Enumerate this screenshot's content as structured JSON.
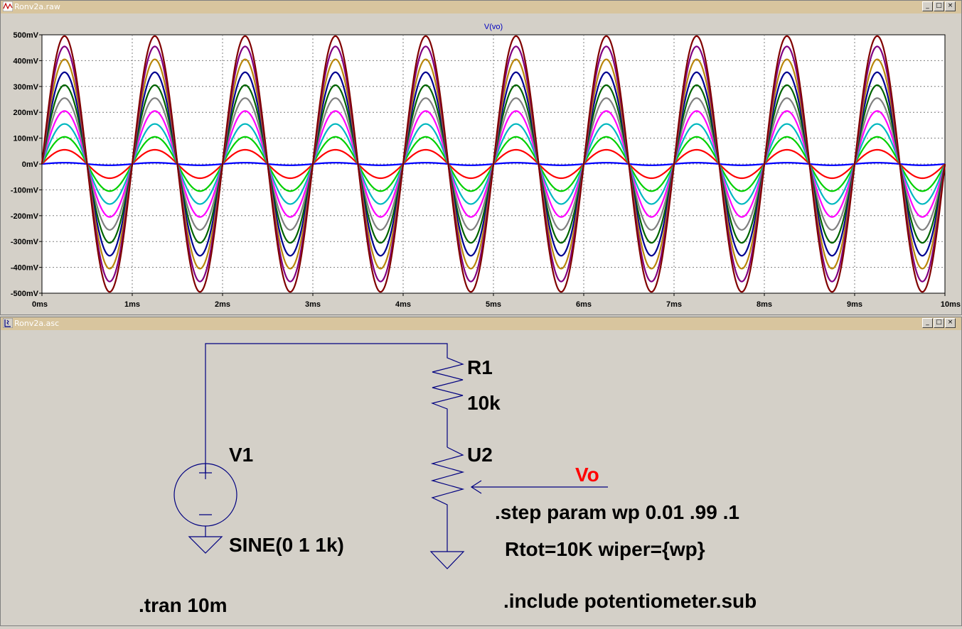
{
  "plot_window": {
    "title": "Ronv2a.raw",
    "trace_label": "V(vo)",
    "icon": "waveform-icon",
    "buttons": {
      "minimize": "_",
      "restore": "□",
      "close": "×"
    }
  },
  "schematic_window": {
    "title": "Ronv2a.asc",
    "icon": "schematic-icon",
    "buttons": {
      "minimize": "_",
      "restore": "□",
      "close": "×"
    },
    "labels": {
      "v1_name": "V1",
      "v1_value": "SINE(0 1 1k)",
      "r1_name": "R1",
      "r1_value": "10k",
      "u2_name": "U2",
      "net_label": "Vo",
      "step_directive": ".step param wp 0.01 .99 .1",
      "u2_params": "Rtot=10K wiper={wp}",
      "tran_directive": ".tran 10m",
      "include_directive": ".include potentiometer.sub"
    },
    "net_label_color": "#ff0000"
  },
  "chart_data": {
    "type": "line",
    "title": "V(vo)",
    "xlabel": "",
    "ylabel": "",
    "x_ticks": [
      "0ms",
      "1ms",
      "2ms",
      "3ms",
      "4ms",
      "5ms",
      "6ms",
      "7ms",
      "8ms",
      "9ms",
      "10ms"
    ],
    "y_ticks": [
      "500mV",
      "400mV",
      "300mV",
      "200mV",
      "100mV",
      "0mV",
      "-100mV",
      "-200mV",
      "-300mV",
      "-400mV",
      "-500mV"
    ],
    "xlim": [
      0,
      10
    ],
    "ylim": [
      -500,
      500
    ],
    "grid": true,
    "frequency_khz": 1,
    "series": [
      {
        "amplitude_mv": 5,
        "color": "#0000ff"
      },
      {
        "amplitude_mv": 55,
        "color": "#ff0000"
      },
      {
        "amplitude_mv": 105,
        "color": "#00d000"
      },
      {
        "amplitude_mv": 155,
        "color": "#00b8c0"
      },
      {
        "amplitude_mv": 205,
        "color": "#ff00ff"
      },
      {
        "amplitude_mv": 255,
        "color": "#808080"
      },
      {
        "amplitude_mv": 305,
        "color": "#006400"
      },
      {
        "amplitude_mv": 355,
        "color": "#000090"
      },
      {
        "amplitude_mv": 405,
        "color": "#b8860b"
      },
      {
        "amplitude_mv": 455,
        "color": "#800080"
      },
      {
        "amplitude_mv": 495,
        "color": "#800000"
      }
    ]
  }
}
